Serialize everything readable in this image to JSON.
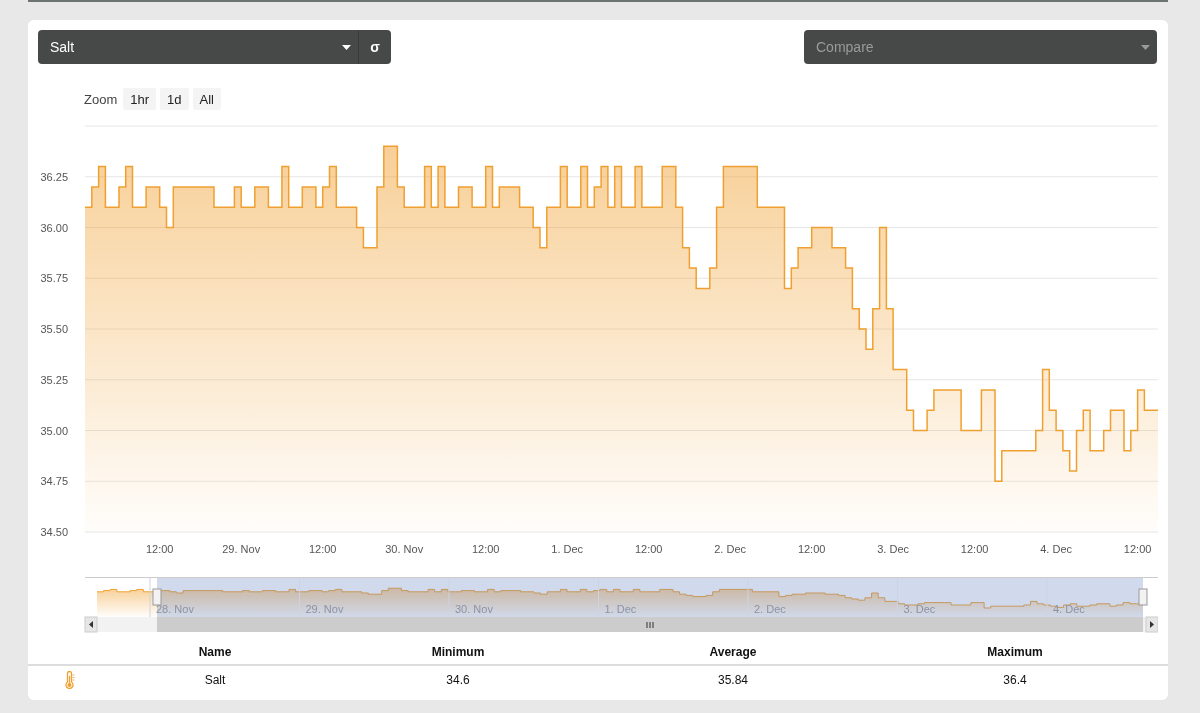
{
  "sensor_select": {
    "value": "Salt"
  },
  "sigma_button": {
    "label": "σ"
  },
  "compare_select": {
    "placeholder": "Compare"
  },
  "zoom": {
    "label": "Zoom",
    "buttons": [
      {
        "label": "1hr",
        "selected": false
      },
      {
        "label": "1d",
        "selected": false
      },
      {
        "label": "All",
        "selected": false
      }
    ]
  },
  "chart_data": {
    "type": "area",
    "grid": true,
    "ylim": [
      34.5,
      36.5
    ],
    "yticks": [
      {
        "value": 34.5,
        "label": "34.50"
      },
      {
        "value": 34.75,
        "label": "34.75"
      },
      {
        "value": 35,
        "label": "35.00"
      },
      {
        "value": 35.25,
        "label": "35.25"
      },
      {
        "value": 35.5,
        "label": "35.50"
      },
      {
        "value": 35.75,
        "label": "35.75"
      },
      {
        "value": 36,
        "label": "36.00"
      },
      {
        "value": 36.25,
        "label": "36.25"
      }
    ],
    "categories": [
      null,
      null,
      null,
      null,
      null,
      null,
      null,
      null,
      null,
      null,
      null,
      "12:00",
      null,
      null,
      null,
      null,
      null,
      null,
      null,
      null,
      null,
      null,
      null,
      "29. Nov",
      null,
      null,
      null,
      null,
      null,
      null,
      null,
      null,
      null,
      null,
      null,
      "12:00",
      null,
      null,
      null,
      null,
      null,
      null,
      null,
      null,
      null,
      null,
      null,
      "30. Nov",
      null,
      null,
      null,
      null,
      null,
      null,
      null,
      null,
      null,
      null,
      null,
      "12:00",
      null,
      null,
      null,
      null,
      null,
      null,
      null,
      null,
      null,
      null,
      null,
      "1. Dec",
      null,
      null,
      null,
      null,
      null,
      null,
      null,
      null,
      null,
      null,
      null,
      "12:00",
      null,
      null,
      null,
      null,
      null,
      null,
      null,
      null,
      null,
      null,
      null,
      "2. Dec",
      null,
      null,
      null,
      null,
      null,
      null,
      null,
      null,
      null,
      null,
      null,
      "12:00",
      null,
      null,
      null,
      null,
      null,
      null,
      null,
      null,
      null,
      null,
      null,
      "3. Dec",
      null,
      null,
      null,
      null,
      null,
      null,
      null,
      null,
      null,
      null,
      null,
      "12:00",
      null,
      null,
      null,
      null,
      null,
      null,
      null,
      null,
      null,
      null,
      null,
      "4. Dec",
      null,
      null,
      null,
      null,
      null,
      null,
      null,
      null,
      null,
      null,
      null,
      "12:00",
      null,
      null,
      null
    ],
    "series": [
      {
        "color": "#f0a030",
        "values": [
          36.1,
          36.2,
          36.3,
          36.1,
          36.1,
          36.2,
          36.3,
          36.1,
          36.1,
          36.2,
          36.2,
          36.1,
          36.0,
          36.2,
          36.2,
          36.2,
          36.2,
          36.2,
          36.2,
          36.1,
          36.1,
          36.1,
          36.2,
          36.1,
          36.1,
          36.2,
          36.2,
          36.1,
          36.1,
          36.3,
          36.1,
          36.1,
          36.2,
          36.2,
          36.1,
          36.2,
          36.3,
          36.1,
          36.1,
          36.1,
          36.0,
          35.9,
          35.9,
          36.2,
          36.4,
          36.4,
          36.2,
          36.1,
          36.1,
          36.1,
          36.3,
          36.1,
          36.3,
          36.1,
          36.1,
          36.2,
          36.2,
          36.1,
          36.1,
          36.3,
          36.1,
          36.2,
          36.2,
          36.2,
          36.1,
          36.1,
          36.0,
          35.9,
          36.1,
          36.1,
          36.3,
          36.1,
          36.1,
          36.3,
          36.1,
          36.2,
          36.3,
          36.1,
          36.3,
          36.1,
          36.1,
          36.3,
          36.1,
          36.1,
          36.1,
          36.3,
          36.3,
          36.1,
          35.9,
          35.8,
          35.7,
          35.7,
          35.8,
          36.1,
          36.3,
          36.3,
          36.3,
          36.3,
          36.3,
          36.1,
          36.1,
          36.1,
          36.1,
          35.7,
          35.8,
          35.9,
          35.9,
          36.0,
          36.0,
          36.0,
          35.9,
          35.9,
          35.8,
          35.6,
          35.5,
          35.4,
          35.6,
          36.0,
          35.6,
          35.3,
          35.3,
          35.1,
          35.0,
          35.0,
          35.1,
          35.2,
          35.2,
          35.2,
          35.2,
          35.0,
          35.0,
          35.0,
          35.2,
          35.2,
          34.75,
          34.9,
          34.9,
          34.9,
          34.9,
          34.9,
          35.0,
          35.3,
          35.1,
          35.0,
          34.9,
          34.8,
          35.0,
          35.1,
          34.9,
          34.9,
          35.0,
          35.1,
          35.1,
          34.9,
          35.0,
          35.2,
          35.1,
          35.1,
          35.1
        ]
      }
    ]
  },
  "navigator": {
    "labels": [
      "28. Nov",
      "29. Nov",
      "30. Nov",
      "1. Dec",
      "2. Dec",
      "3. Dec",
      "4. Dec"
    ]
  },
  "table": {
    "columns": [
      "Name",
      "Minimum",
      "Average",
      "Maximum"
    ],
    "rows": [
      {
        "cells": [
          "Salt",
          "34.6",
          "35.84",
          "36.4"
        ]
      }
    ]
  }
}
